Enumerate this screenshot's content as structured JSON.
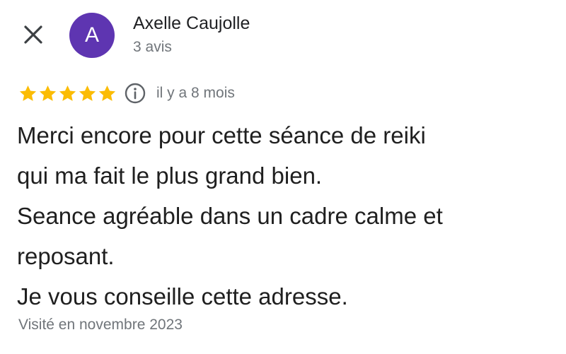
{
  "close": {
    "icon": "close-icon"
  },
  "author": {
    "initial": "A",
    "name": "Axelle Caujolle",
    "review_count": "3 avis",
    "avatar_color": "#5e35b1"
  },
  "rating": {
    "stars": 5,
    "max_stars": 5,
    "star_color": "#fbbc04",
    "info_icon": "info-icon",
    "time_ago": "il y a 8 mois"
  },
  "review": {
    "lines": [
      "Merci encore pour cette séance de reiki",
      "qui ma fait le plus grand bien.",
      "Seance agréable dans un cadre calme et",
      "reposant.",
      "Je vous conseille cette adresse."
    ]
  },
  "visit": {
    "date_text": "Visité en novembre 2023"
  }
}
